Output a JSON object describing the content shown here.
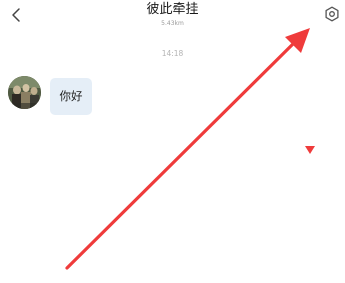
{
  "header": {
    "back_icon": "chevron-left-icon",
    "title": "彼此牵挂",
    "distance": "5.43km",
    "settings_icon": "gear-icon"
  },
  "chat": {
    "timestamp": "14:18",
    "messages": [
      {
        "sender": "other",
        "avatar_icon": "avatar-photo",
        "text": "你好"
      }
    ]
  },
  "annotation": {
    "arrow_color": "#ef3b3b",
    "marker_color": "#ef3b3b"
  }
}
